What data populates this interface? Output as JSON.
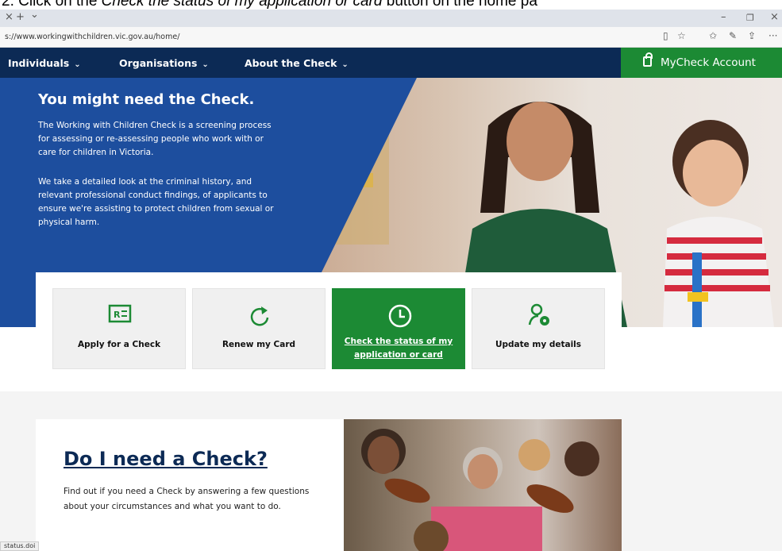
{
  "caption": {
    "prefix": "2.   Click on the ",
    "emphasis": "Check the status of my application or card",
    "suffix": " button on the home pa"
  },
  "browser": {
    "tab_close": "×",
    "tab_new": "+",
    "tab_menu": "⌄",
    "window_min": "–",
    "window_max": "❐",
    "window_close": "×",
    "url": "s://www.workingwithchildren.vic.gov.au/home/",
    "icons": {
      "reader": "▯",
      "favorite": "☆",
      "favorites_bar": "✩",
      "pen": "✎",
      "share": "⇪",
      "more": "···"
    }
  },
  "nav": {
    "items": [
      {
        "label": "Individuals",
        "chevron": "⌄"
      },
      {
        "label": "Organisations",
        "chevron": "⌄"
      },
      {
        "label": "About the Check",
        "chevron": "⌄"
      }
    ],
    "account_label": "MyCheck Account"
  },
  "hero": {
    "title": "You might need the Check.",
    "para1": "The Working with Children Check is a screening process for assessing or re-assessing people who work with or care for children in Victoria.",
    "para2": "We take a detailed look at the criminal history, and relevant professional conduct findings, of applicants to ensure we're assisting to protect children from sexual or physical harm."
  },
  "cards": [
    {
      "label": "Apply for a Check",
      "icon": "id-card-icon"
    },
    {
      "label": "Renew my Card",
      "icon": "refresh-icon"
    },
    {
      "label": "Check the status of my application or card",
      "icon": "clock-icon",
      "active": true
    },
    {
      "label": "Update my details",
      "icon": "user-settings-icon"
    }
  ],
  "colors": {
    "navy": "#0c2a55",
    "hero_blue": "#1d4e9e",
    "green": "#1c8a34"
  },
  "lower": {
    "title": "Do I need a Check?",
    "text": "Find out if you need a Check by answering a few questions about your circumstances and what you want to do."
  },
  "status_text": "status.doi"
}
